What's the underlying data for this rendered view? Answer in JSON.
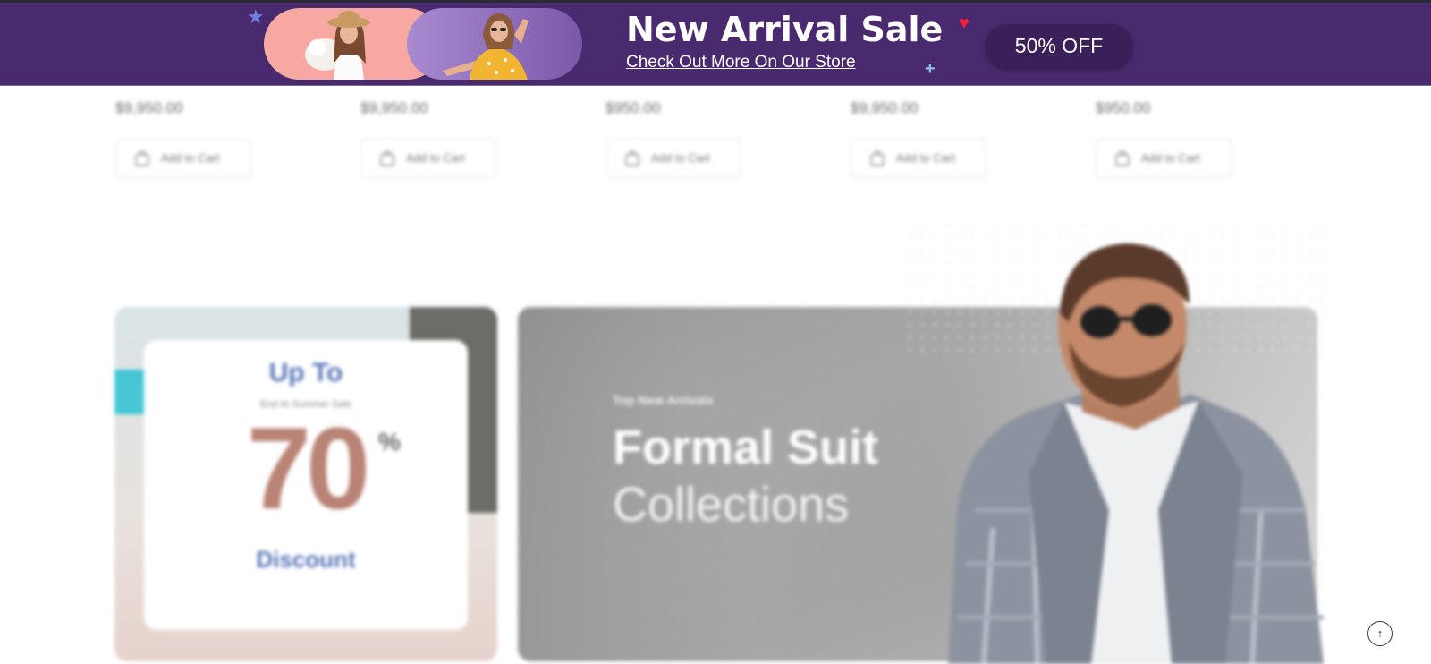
{
  "promo_banner": {
    "headline": "New Arrival Sale",
    "subline": "Check Out More On Our Store",
    "offer_label": "50% OFF",
    "colors": {
      "background": "#4a2a6e",
      "button": "#3a1f58",
      "pill_left": "#f7a8a2",
      "pill_right": "#8e6cbc"
    },
    "decorations": [
      "star-icon",
      "heart-icon",
      "plus-icon"
    ]
  },
  "products": [
    {
      "price": "$9,950.00",
      "cart_label": "Add to Cart"
    },
    {
      "price": "$9,950.00",
      "cart_label": "Add to Cart"
    },
    {
      "price": "$950.00",
      "cart_label": "Add to Cart"
    },
    {
      "price": "$9,950.00",
      "cart_label": "Add to Cart"
    },
    {
      "price": "$950.00",
      "cart_label": "Add to Cart"
    }
  ],
  "discount_card": {
    "top_text": "Up To",
    "small_text": "End At Summer Sale",
    "number": "70",
    "percent_sign": "%",
    "bottom_text": "Discount"
  },
  "suit_banner": {
    "eyebrow": "Top New Arrivals",
    "title": "Formal Suit",
    "subtitle": "Collections"
  },
  "scroll_top": {
    "icon": "arrow-up-icon",
    "glyph": "↑"
  }
}
